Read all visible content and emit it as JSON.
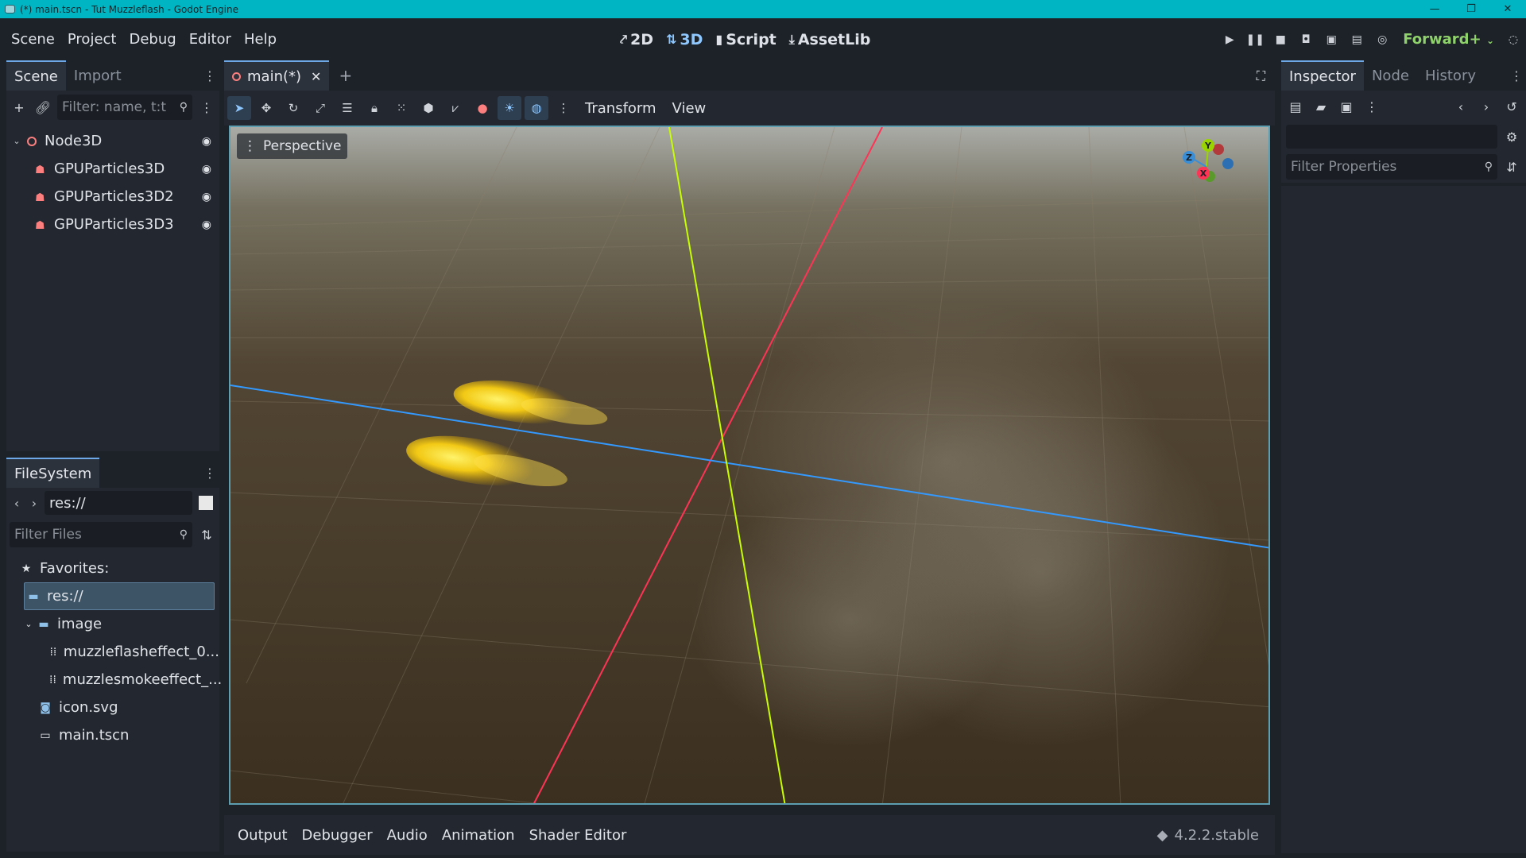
{
  "window": {
    "title": "(*) main.tscn - Tut Muzzleflash - Godot Engine",
    "controls": [
      "—",
      "❐",
      "✕"
    ]
  },
  "menu": {
    "items": [
      "Scene",
      "Project",
      "Debug",
      "Editor",
      "Help"
    ]
  },
  "workspaces": {
    "items": [
      {
        "label": "2D",
        "icon": "2d-icon"
      },
      {
        "label": "3D",
        "icon": "3d-icon",
        "active": true
      },
      {
        "label": "Script",
        "icon": "script-icon"
      },
      {
        "label": "AssetLib",
        "icon": "assetlib-icon"
      }
    ]
  },
  "run": {
    "renderer": "Forward+"
  },
  "scene_dock": {
    "tabs": [
      "Scene",
      "Import"
    ],
    "filter_placeholder": "Filter: name, t:t",
    "nodes": [
      {
        "label": "Node3D",
        "icon": "node3d-icon",
        "expanded": true
      },
      {
        "label": "GPUParticles3D",
        "icon": "gpuparticles-icon"
      },
      {
        "label": "GPUParticles3D2",
        "icon": "gpuparticles-icon"
      },
      {
        "label": "GPUParticles3D3",
        "icon": "gpuparticles-icon"
      }
    ]
  },
  "filesystem": {
    "tab": "FileSystem",
    "path": "res://",
    "filter_placeholder": "Filter Files",
    "favorites": "Favorites:",
    "items": [
      {
        "label": "res://",
        "icon": "folder-icon",
        "selected": true
      },
      {
        "label": "image",
        "icon": "folder-icon"
      },
      {
        "label": "muzzleflasheffect_0...",
        "icon": "texture-icon"
      },
      {
        "label": "muzzlesmokeeffect_...",
        "icon": "texture-icon"
      },
      {
        "label": "icon.svg",
        "icon": "svg-icon"
      },
      {
        "label": "main.tscn",
        "icon": "scene-icon"
      }
    ]
  },
  "editor": {
    "scene_tab": "main(*)",
    "toolbar_menus": [
      "Transform",
      "View"
    ],
    "viewport_label": "Perspective",
    "gizmo_axes": [
      "Y",
      "Z",
      "X"
    ]
  },
  "bottom_panel": {
    "tabs": [
      "Output",
      "Debugger",
      "Audio",
      "Animation",
      "Shader Editor"
    ],
    "version": "4.2.2.stable"
  },
  "inspector": {
    "tabs": [
      "Inspector",
      "Node",
      "History"
    ],
    "filter_placeholder": "Filter Properties"
  },
  "colors": {
    "accent": "#6fa8e6",
    "title_bar": "#00b5c3",
    "axis_x": "#ff3355",
    "axis_y": "#c8ff00",
    "axis_z": "#3399ff",
    "renderer": "#8fd26b"
  }
}
